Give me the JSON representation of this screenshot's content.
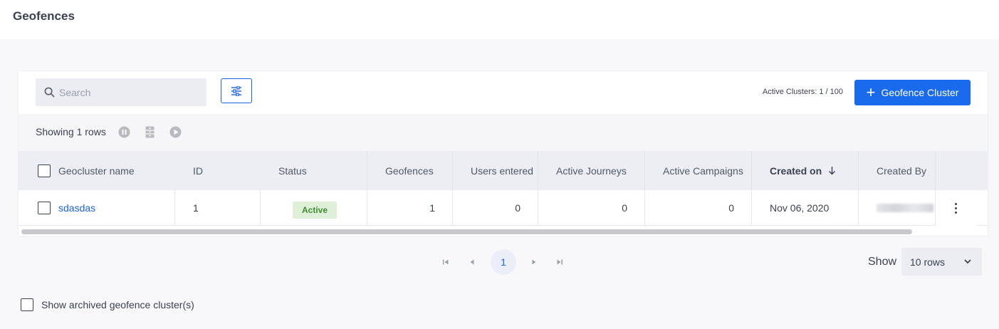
{
  "page": {
    "title": "Geofences"
  },
  "search": {
    "placeholder": "Search",
    "value": ""
  },
  "header": {
    "active_clusters": "Active Clusters: 1 / 100",
    "add_button_label": "Geofence Cluster"
  },
  "toolbar": {
    "showing": "Showing 1 rows"
  },
  "table": {
    "columns": {
      "name": "Geocluster name",
      "id": "ID",
      "status": "Status",
      "geofences": "Geofences",
      "users_entered": "Users entered",
      "active_journeys": "Active Journeys",
      "active_campaigns": "Active Campaigns",
      "created_on": "Created on",
      "created_by": "Created By"
    },
    "sort_column": "created_on",
    "sort_direction": "desc",
    "rows": [
      {
        "name": "sdasdas",
        "id": "1",
        "status": "Active",
        "geofences": "1",
        "users_entered": "0",
        "active_journeys": "0",
        "active_campaigns": "0",
        "created_on": "Nov 06, 2020",
        "created_by": ""
      }
    ]
  },
  "pagination": {
    "current_page": "1"
  },
  "rows_per_page": {
    "label": "Show",
    "value": "10 rows"
  },
  "footer": {
    "archived_label": "Show archived geofence cluster(s)"
  },
  "colors": {
    "accent": "#1a6aee",
    "link": "#1a62e4",
    "status_active_bg": "#dff0d8",
    "status_active_text": "#3f8a2f"
  },
  "icons": {
    "search": "search-icon",
    "filter": "sliders-icon",
    "pause": "pause-icon",
    "archive": "archive-icon",
    "play": "play-icon",
    "sort": "arrow-down-icon",
    "more": "kebab-icon"
  }
}
